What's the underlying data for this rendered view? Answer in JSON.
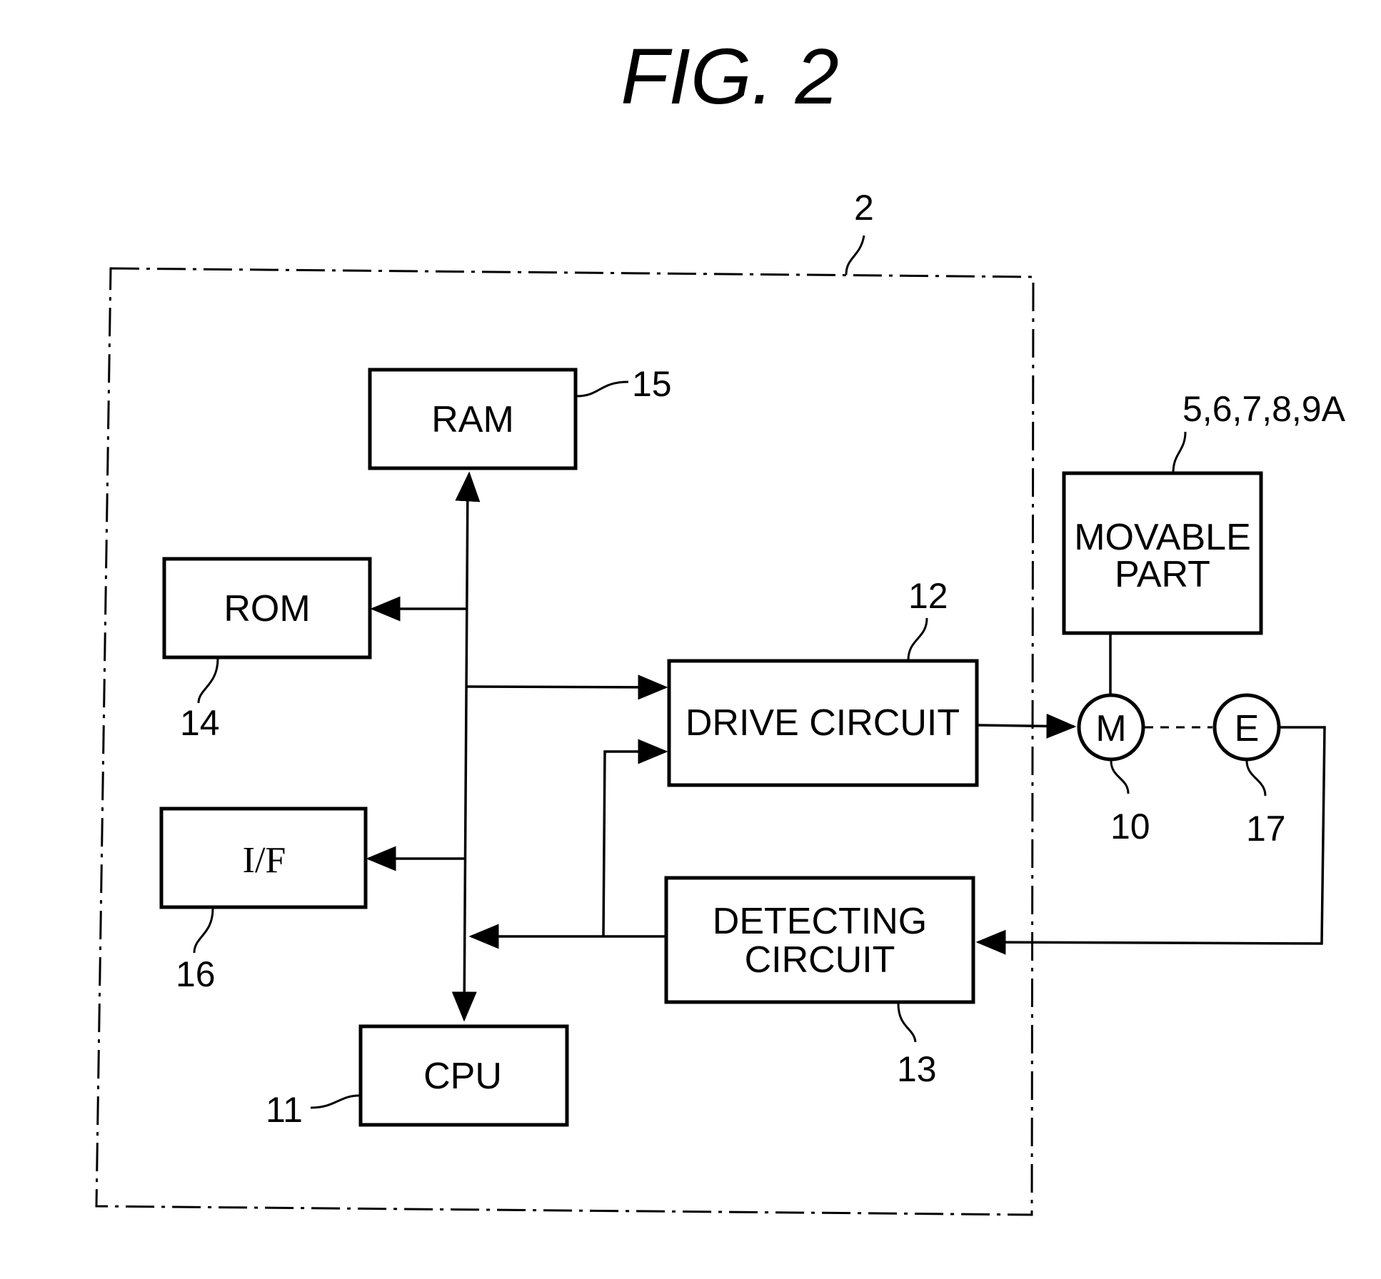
{
  "figure": {
    "title": "FIG. 2"
  },
  "controller": {
    "ref": "2"
  },
  "blocks": {
    "ram": {
      "label": "RAM",
      "ref": "15"
    },
    "rom": {
      "label": "ROM",
      "ref": "14"
    },
    "interface": {
      "label": "I/F",
      "ref": "16"
    },
    "cpu": {
      "label": "CPU",
      "ref": "11"
    },
    "drive_circuit": {
      "label": "DRIVE CIRCUIT",
      "ref": "12"
    },
    "detecting_circuit": {
      "label_line1": "DETECTING",
      "label_line2": "CIRCUIT",
      "ref": "13"
    },
    "movable_part": {
      "label_line1": "MOVABLE",
      "label_line2": "PART",
      "ref": "5,6,7,8,9A"
    }
  },
  "components": {
    "motor": {
      "symbol": "M",
      "ref": "10"
    },
    "encoder": {
      "symbol": "E",
      "ref": "17"
    }
  },
  "connections": [
    {
      "from": "bus",
      "to": "RAM",
      "type": "bidirectional"
    },
    {
      "from": "bus",
      "to": "ROM",
      "type": "arrow"
    },
    {
      "from": "bus",
      "to": "I/F",
      "type": "arrow"
    },
    {
      "from": "bus",
      "to": "CPU",
      "type": "arrow"
    },
    {
      "from": "bus",
      "to": "DRIVE CIRCUIT",
      "type": "arrow"
    },
    {
      "from": "DETECTING CIRCUIT",
      "to": "bus",
      "type": "arrow"
    },
    {
      "from": "DETECTING CIRCUIT",
      "to": "DRIVE CIRCUIT",
      "type": "arrow"
    },
    {
      "from": "DRIVE CIRCUIT",
      "to": "M",
      "type": "arrow"
    },
    {
      "from": "M",
      "to": "E",
      "type": "mechanical-dashed"
    },
    {
      "from": "M",
      "to": "MOVABLE PART",
      "type": "line"
    },
    {
      "from": "E",
      "to": "DETECTING CIRCUIT",
      "type": "arrow"
    }
  ]
}
